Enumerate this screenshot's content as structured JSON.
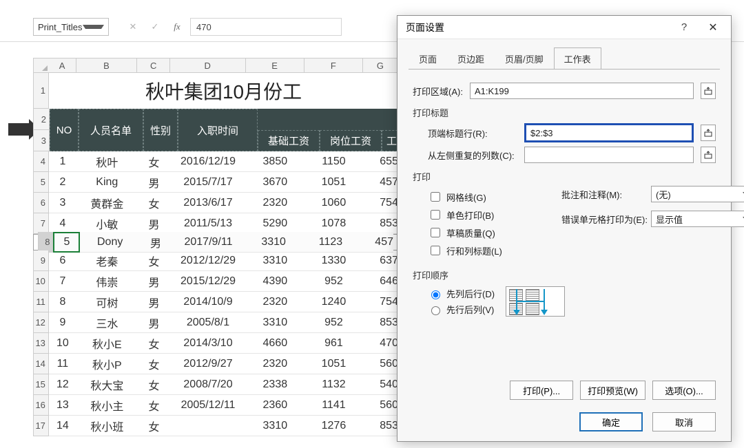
{
  "formulaBar": {
    "nameBox": "Print_Titles",
    "cancelGlyph": "✕",
    "enterGlyph": "✓",
    "fxLabel": "fx",
    "value": "470"
  },
  "columns": [
    "A",
    "B",
    "C",
    "D",
    "E",
    "F",
    "G"
  ],
  "titleRow": "秋叶集团10月份工",
  "header": {
    "no": "NO",
    "name": "人员名单",
    "sex": "性别",
    "date": "入职时间",
    "e": "基础工资",
    "f": "岗位工资",
    "g": "工龄工"
  },
  "rows": [
    {
      "rn": "4",
      "no": "1",
      "name": "秋叶",
      "sex": "女",
      "date": "2016/12/19",
      "e": "3850",
      "f": "1150",
      "g": "655"
    },
    {
      "rn": "5",
      "no": "2",
      "name": "King",
      "sex": "男",
      "date": "2015/7/17",
      "e": "3670",
      "f": "1051",
      "g": "457"
    },
    {
      "rn": "6",
      "no": "3",
      "name": "黄群金",
      "sex": "女",
      "date": "2013/6/17",
      "e": "2320",
      "f": "1060",
      "g": "754"
    },
    {
      "rn": "7",
      "no": "4",
      "name": "小敏",
      "sex": "男",
      "date": "2011/5/13",
      "e": "5290",
      "f": "1078",
      "g": "853"
    },
    {
      "rn": "8",
      "no": "5",
      "name": "Dony",
      "sex": "男",
      "date": "2017/9/11",
      "e": "3310",
      "f": "1123",
      "g": "457",
      "sel": true
    },
    {
      "rn": "9",
      "no": "6",
      "name": "老秦",
      "sex": "女",
      "date": "2012/12/29",
      "e": "3310",
      "f": "1330",
      "g": "637"
    },
    {
      "rn": "10",
      "no": "7",
      "name": "伟崇",
      "sex": "男",
      "date": "2015/12/29",
      "e": "4390",
      "f": "952",
      "g": "646"
    },
    {
      "rn": "11",
      "no": "8",
      "name": "可树",
      "sex": "男",
      "date": "2014/10/9",
      "e": "2320",
      "f": "1240",
      "g": "754"
    },
    {
      "rn": "12",
      "no": "9",
      "name": "三水",
      "sex": "男",
      "date": "2005/8/1",
      "e": "3310",
      "f": "952",
      "g": "853"
    },
    {
      "rn": "13",
      "no": "10",
      "name": "秋小E",
      "sex": "女",
      "date": "2014/3/10",
      "e": "4660",
      "f": "961",
      "g": "470"
    },
    {
      "rn": "14",
      "no": "11",
      "name": "秋小P",
      "sex": "女",
      "date": "2012/9/27",
      "e": "2320",
      "f": "1051",
      "g": "560"
    },
    {
      "rn": "15",
      "no": "12",
      "name": "秋大宝",
      "sex": "女",
      "date": "2008/7/20",
      "e": "2338",
      "f": "1132",
      "g": "540"
    },
    {
      "rn": "16",
      "no": "13",
      "name": "秋小主",
      "sex": "女",
      "date": "2005/12/11",
      "e": "2360",
      "f": "1141",
      "g": "560"
    },
    {
      "rn": "17",
      "no": "14",
      "name": "秋小班",
      "sex": "女",
      "date": "",
      "e": "3310",
      "f": "1276",
      "g": "853"
    }
  ],
  "rowHeaders23": [
    "2",
    "3"
  ],
  "rowHeader1": "1",
  "dialog": {
    "title": "页面设置",
    "help": "?",
    "close": "✕",
    "tabs": [
      "页面",
      "页边距",
      "页眉/页脚",
      "工作表"
    ],
    "activeTab": 3,
    "printArea": {
      "label": "打印区域(A):",
      "value": "A1:K199"
    },
    "printTitles": "打印标题",
    "topRow": {
      "label": "顶端标题行(R):",
      "value": "$2:$3"
    },
    "leftCol": {
      "label": "从左侧重复的列数(C):",
      "value": ""
    },
    "printSection": "打印",
    "checks": {
      "grid": "网格线(G)",
      "mono": "单色打印(B)",
      "draft": "草稿质量(Q)",
      "rowcol": "行和列标题(L)"
    },
    "comments": {
      "label": "批注和注释(M):",
      "value": "(无)"
    },
    "errors": {
      "label": "错误单元格打印为(E):",
      "value": "显示值"
    },
    "orderSection": "打印顺序",
    "order": {
      "down": "先列后行(D)",
      "over": "先行后列(V)"
    },
    "buttons": {
      "print": "打印(P)...",
      "preview": "打印预览(W)",
      "options": "选项(O)..."
    },
    "footer": {
      "ok": "确定",
      "cancel": "取消"
    }
  }
}
